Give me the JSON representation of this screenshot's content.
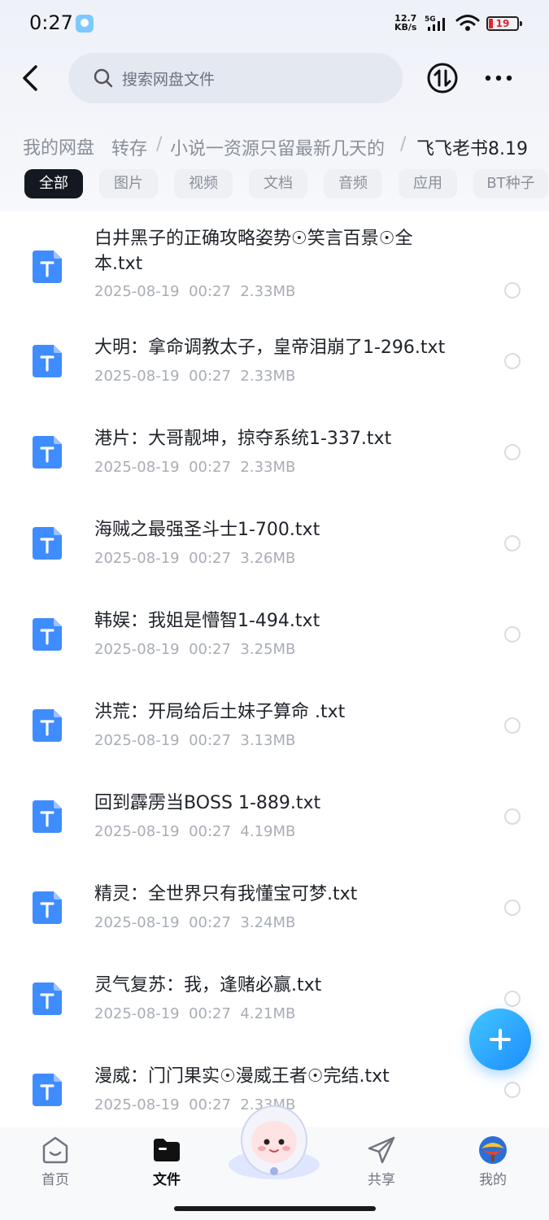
{
  "status_bar": {
    "time": "0:27",
    "speed_value": "12.7",
    "speed_unit": "KB/s",
    "network": "5G",
    "battery": "19"
  },
  "header": {
    "search_placeholder": "搜索网盘文件"
  },
  "breadcrumb": {
    "root": "我的网盘",
    "items": [
      "转存",
      "小说一资源只留最新几天的",
      "飞飞老书8.19"
    ],
    "separator": "/"
  },
  "tabs": {
    "items": [
      "全部",
      "图片",
      "视频",
      "文档",
      "音频",
      "应用",
      "BT种子"
    ],
    "active_index": 0
  },
  "files": [
    {
      "name": "白井黑子的正确攻略姿势☉笑言百景☉全本.txt",
      "date": "2025-08-19",
      "time": "00:27",
      "size": "2.33MB"
    },
    {
      "name": "大明：拿命调教太子，皇帝泪崩了1-296.txt",
      "date": "2025-08-19",
      "time": "00:27",
      "size": "2.33MB"
    },
    {
      "name": "港片：大哥靓坤，掠夺系统1-337.txt",
      "date": "2025-08-19",
      "time": "00:27",
      "size": "2.33MB"
    },
    {
      "name": "海贼之最强圣斗士1-700.txt",
      "date": "2025-08-19",
      "time": "00:27",
      "size": "3.26MB"
    },
    {
      "name": "韩娱：我姐是懵智1-494.txt",
      "date": "2025-08-19",
      "time": "00:27",
      "size": "3.25MB"
    },
    {
      "name": "洪荒：开局给后土妹子算命 .txt",
      "date": "2025-08-19",
      "time": "00:27",
      "size": "3.13MB"
    },
    {
      "name": "回到霹雳当BOSS 1-889.txt",
      "date": "2025-08-19",
      "time": "00:27",
      "size": "4.19MB"
    },
    {
      "name": "精灵：全世界只有我懂宝可梦.txt",
      "date": "2025-08-19",
      "time": "00:27",
      "size": "3.24MB"
    },
    {
      "name": "灵气复苏：我，逢赌必赢.txt",
      "date": "2025-08-19",
      "time": "00:27",
      "size": "4.21MB"
    },
    {
      "name": "漫威：门门果实☉漫威王者☉完结.txt",
      "date": "2025-08-19",
      "time": "00:27",
      "size": "2.33MB"
    }
  ],
  "bottom_nav": {
    "items": [
      {
        "label": "首页",
        "icon": "home-icon"
      },
      {
        "label": "文件",
        "icon": "folder-icon"
      },
      {
        "label": "共享",
        "icon": "share-icon"
      },
      {
        "label": "我的",
        "icon": "avatar-icon"
      }
    ],
    "active_index": 1
  },
  "colors": {
    "accent": "#1c8dff",
    "file_icon": "#3f8cff",
    "active_tab": "#141820"
  }
}
